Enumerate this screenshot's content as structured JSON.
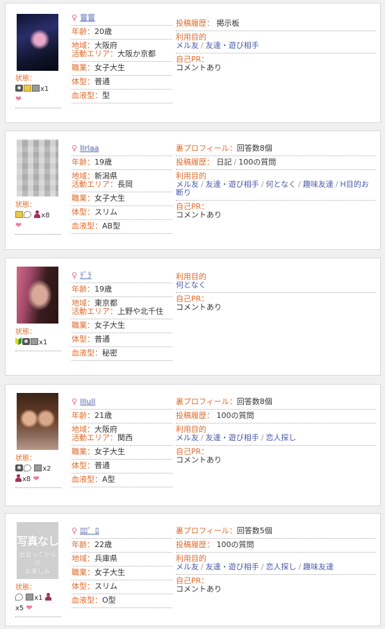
{
  "labels": {
    "status": "状態：",
    "age": "年齢：",
    "region": "地域：",
    "area": "活動エリア：",
    "job": "職業：",
    "body": "体型：",
    "blood": "血液型：",
    "ura": "裏プロフィール：",
    "history": "投稿履歴：",
    "purpose": "利用目的",
    "pr": "自己PR：",
    "sex": "♀"
  },
  "colors": {
    "label": "#e06a2a",
    "link": "#4a5aa8",
    "heart": "#f07a9a",
    "person": "#a0305a"
  },
  "profiles": [
    {
      "nickname": "冒冒",
      "age": "20歳",
      "region": "大阪府",
      "area": "大阪か京都",
      "job": "女子大生",
      "body": "普通",
      "blood": "型",
      "history": "掲示板",
      "purpose_items": [
        "メル友",
        "友達・遊び相手"
      ],
      "pr": "コメントあり",
      "status_count": "x1"
    },
    {
      "nickname": "Ilrlaa",
      "age": "19歳",
      "region": "新潟県",
      "area": "長岡",
      "job": "女子大生",
      "body": "スリム",
      "blood": "AB型",
      "ura": "回答数8個",
      "history_items": [
        "日記",
        "100の質問"
      ],
      "purpose_items": [
        "メル友",
        "友達・遊び相手",
        "何となく",
        "趣味友達",
        "H目的お断り"
      ],
      "pr": "コメントあり",
      "status_count": "x8"
    },
    {
      "nickname": "ﾃﾞﾗ",
      "age": "19歳",
      "region": "東京都",
      "area": "上野や北千住",
      "job": "女子大生",
      "body": "普通",
      "blood": "秘密",
      "purpose_items": [
        "何となく"
      ],
      "pr": "コメントあり",
      "status_count": "x1"
    },
    {
      "nickname": "lllull",
      "age": "21歳",
      "region": "大阪府",
      "area": "関西",
      "job": "女子大生",
      "body": "普通",
      "blood": "A型",
      "ura": "回答数8個",
      "history": "100の質問",
      "purpose_items": [
        "メル友",
        "友達・遊び相手",
        "恋人探し"
      ],
      "pr": "コメントあり",
      "status_count_1": "x2",
      "status_count_2": "x8"
    },
    {
      "nickname": "ﾛﾛ゛ﾛ",
      "age": "22歳",
      "region": "兵庫県",
      "job": "女子大生",
      "body": "スリム",
      "blood": "O型",
      "ura": "回答数5個",
      "history": "100の質問",
      "purpose_items": [
        "メル友",
        "友達・遊び相手",
        "恋人探し",
        "趣味友達"
      ],
      "pr": "コメントあり",
      "status_count_1": "x1",
      "status_count_2": "x5",
      "noimage_big": "写真なし",
      "noimage_small_1": "出会ってからの",
      "noimage_small_2": "お楽しみ"
    }
  ]
}
